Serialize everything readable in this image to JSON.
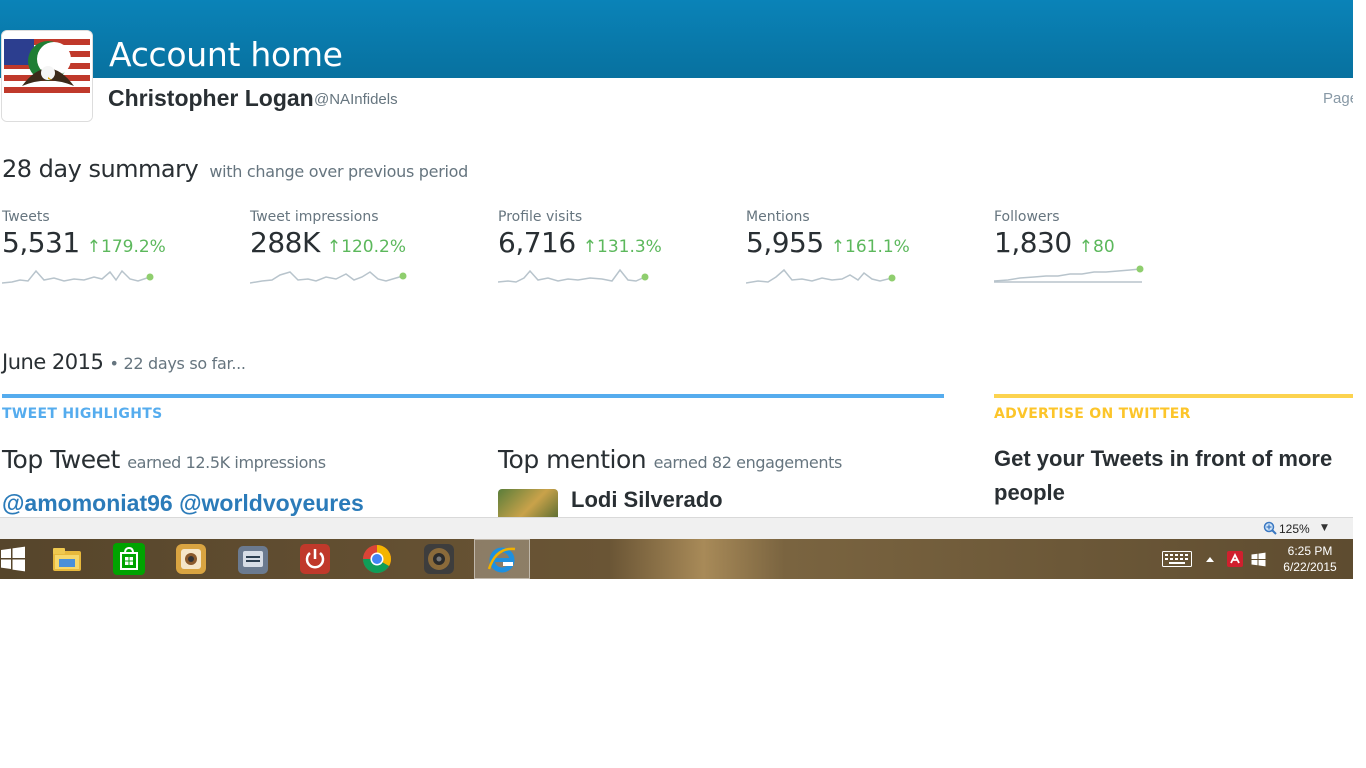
{
  "header": {
    "title": "Account home",
    "name": "Christopher Logan",
    "handle": "@NAInfidels",
    "page_link": "Page"
  },
  "summary": {
    "title": "28 day summary",
    "subtitle": "with change over previous period",
    "stats": [
      {
        "label": "Tweets",
        "value": "5,531",
        "change": "179.2%"
      },
      {
        "label": "Tweet impressions",
        "value": "288K",
        "change": "120.2%"
      },
      {
        "label": "Profile visits",
        "value": "6,716",
        "change": "131.3%"
      },
      {
        "label": "Mentions",
        "value": "5,955",
        "change": "161.1%"
      },
      {
        "label": "Followers",
        "value": "1,830",
        "change": "80"
      }
    ]
  },
  "month": {
    "title": "June 2015",
    "subtitle": "• 22 days so far..."
  },
  "highlights": {
    "label": "TWEET HIGHLIGHTS",
    "top_tweet_title": "Top Tweet",
    "top_tweet_sub": "earned 12.5K impressions",
    "top_tweet_text": "@amomoniat96 @worldvoyeures",
    "top_mention_title": "Top mention",
    "top_mention_sub": "earned 82 engagements",
    "top_mention_name": "Lodi Silverado"
  },
  "ads": {
    "label": "ADVERTISE ON TWITTER",
    "text": "Get your Tweets in front of more people"
  },
  "statusbar": {
    "zoom": "125%"
  },
  "taskbar": {
    "time": "6:25 PM",
    "date": "6/22/2015",
    "apps": [
      "start-icon",
      "file-explorer-icon",
      "store-icon",
      "photo-app-icon",
      "doc-app-icon",
      "power-icon",
      "chrome-icon",
      "speaker-icon",
      "internet-explorer-icon"
    ]
  },
  "colors": {
    "header": "#0a83b8",
    "positive": "#5cb85c",
    "link": "#2b7bb9",
    "highlights_accent": "#55acee",
    "ads_accent": "#fcc52a"
  }
}
